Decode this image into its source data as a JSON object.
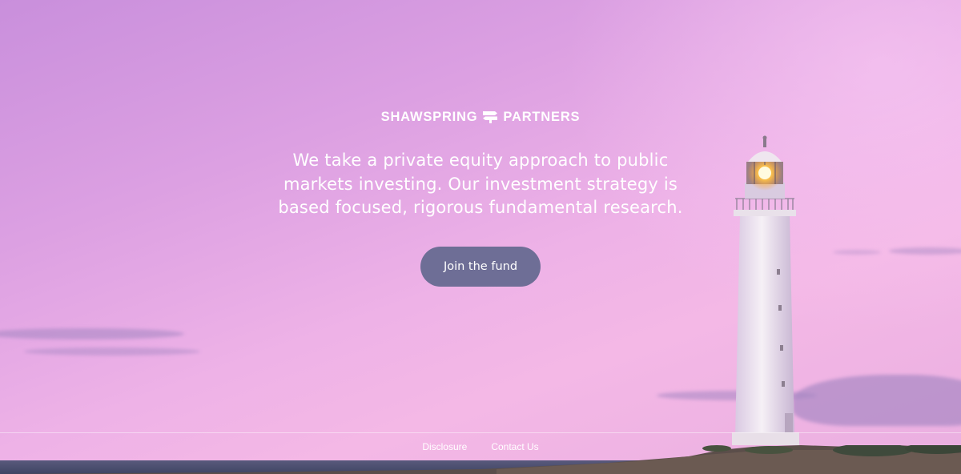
{
  "brand": {
    "name_left": "SHAWSPRING",
    "name_right": "PARTNERS",
    "logo_icon": "signpost-icon"
  },
  "hero": {
    "tagline": "We take a private equity approach to public markets investing. Our investment strategy is based focused, rigorous fundamental research.",
    "cta_label": "Join the fund",
    "background_image": "lighthouse-at-dusk"
  },
  "footer": {
    "links": [
      "Disclosure",
      "Contact Us"
    ]
  },
  "colors": {
    "cta_background": "#6e6e96",
    "text": "#ffffff",
    "sky_top": "#c98fdc",
    "sky_bottom": "#f4b8e6"
  }
}
